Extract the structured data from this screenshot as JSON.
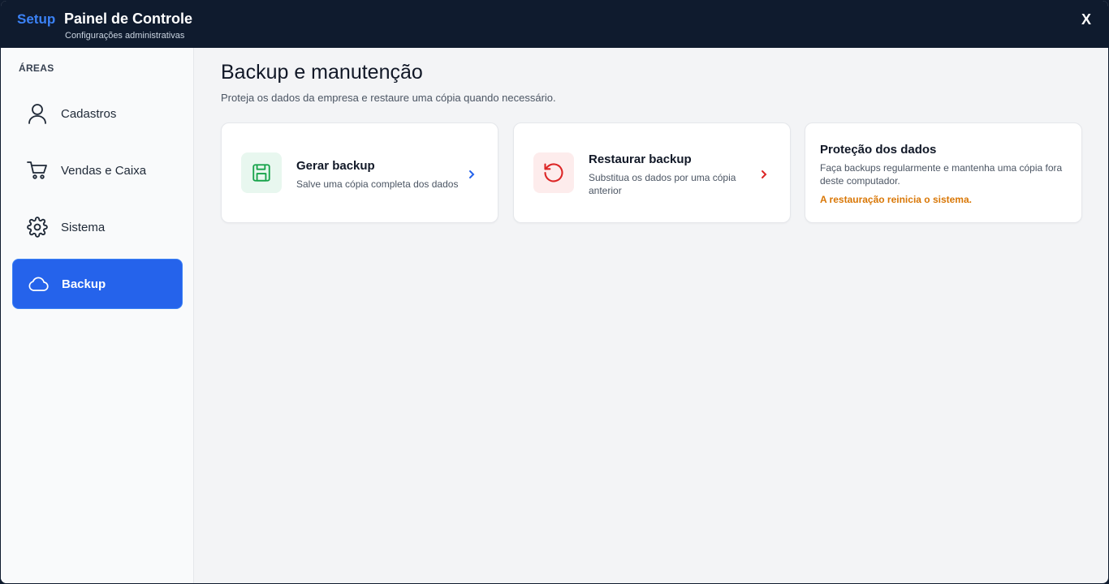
{
  "header": {
    "brand": "Setup",
    "title": "Painel de Controle",
    "subtitle": "Configurações administrativas",
    "close_label": "X"
  },
  "sidebar": {
    "heading": "ÁREAS",
    "items": [
      {
        "label": "Cadastros",
        "icon": "user-icon",
        "active": false
      },
      {
        "label": "Vendas e Caixa",
        "icon": "cart-icon",
        "active": false
      },
      {
        "label": "Sistema",
        "icon": "gear-icon",
        "active": false
      },
      {
        "label": "Backup",
        "icon": "cloud-icon",
        "active": true
      }
    ]
  },
  "main": {
    "title": "Backup e manutenção",
    "subtitle": "Proteja os dados da empresa e restaure uma cópia quando necessário.",
    "cards": [
      {
        "title": "Gerar backup",
        "description": "Salve uma cópia completa dos dados",
        "icon": "floppy-disk-icon",
        "accent": "#16a34a"
      },
      {
        "title": "Restaurar backup",
        "description": "Substitua os dados por uma cópia anterior",
        "icon": "restore-icon",
        "accent": "#dc2626"
      }
    ],
    "info": {
      "title": "Proteção dos dados",
      "description": "Faça backups regularmente e mantenha uma cópia fora deste computador.",
      "warning": "A restauração reinicia o sistema."
    }
  },
  "colors": {
    "header_bg": "#0f1b2e",
    "brand": "#3b82f6",
    "active_nav": "#2563eb",
    "warning": "#d97706"
  }
}
